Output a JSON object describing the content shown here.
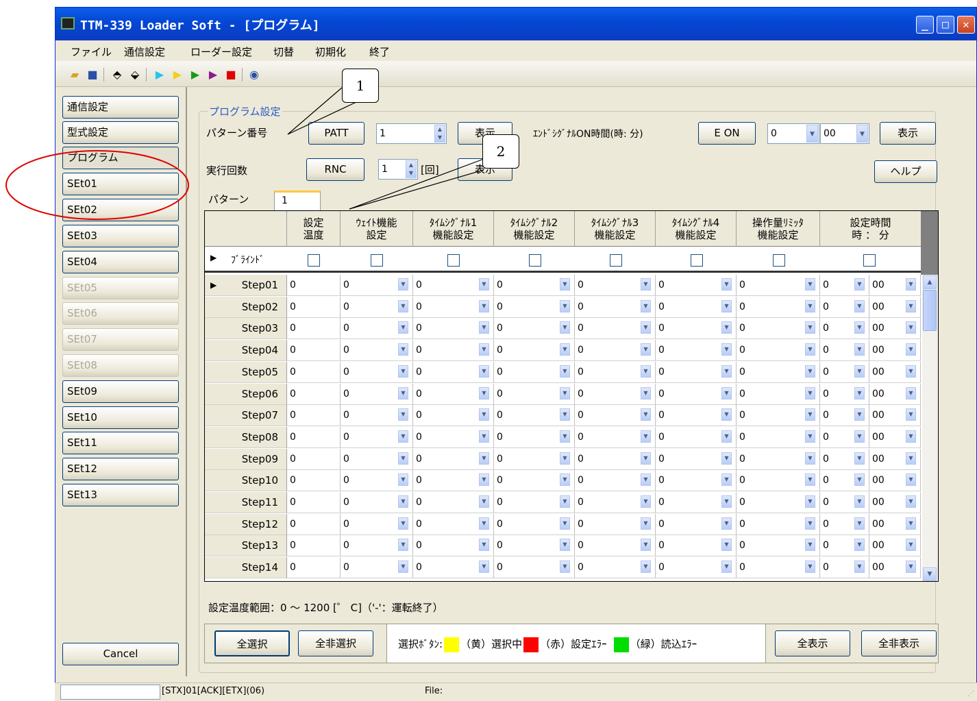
{
  "window": {
    "title": "TTM-339 Loader Soft - [プログラム]"
  },
  "menu": [
    "ファイル",
    "通信設定",
    "ローダー設定",
    "切替",
    "初期化",
    "終了"
  ],
  "toolbar": {
    "icons": [
      "open-folder-icon",
      "save-icon",
      "upload-icon",
      "download-icon",
      "play-cyan-icon",
      "play-yellow-icon",
      "play-green-icon",
      "play-purple-icon",
      "stop-red-icon",
      "help-icon"
    ]
  },
  "sidebar": {
    "items": [
      {
        "label": "通信設定",
        "enabled": true
      },
      {
        "label": "型式設定",
        "enabled": true
      },
      {
        "label": "プログラム",
        "enabled": true
      },
      {
        "label": "SEt01",
        "enabled": true
      },
      {
        "label": "SEt02",
        "enabled": true
      },
      {
        "label": "SEt03",
        "enabled": true
      },
      {
        "label": "SEt04",
        "enabled": true
      },
      {
        "label": "SEt05",
        "enabled": false
      },
      {
        "label": "SEt06",
        "enabled": false
      },
      {
        "label": "SEt07",
        "enabled": false
      },
      {
        "label": "SEt08",
        "enabled": false
      },
      {
        "label": "SEt09",
        "enabled": true
      },
      {
        "label": "SEt10",
        "enabled": true
      },
      {
        "label": "SEt11",
        "enabled": true
      },
      {
        "label": "SEt12",
        "enabled": true
      },
      {
        "label": "SEt13",
        "enabled": true
      }
    ],
    "cancel": "Cancel"
  },
  "program": {
    "group_title": "プログラム設定",
    "pattern_no_label": "パターン番号",
    "patt_button": "PATT",
    "pattern_value": "1",
    "show_button": "表示",
    "end_signal_label": "ｴﾝﾄﾞｼｸﾞﾅﾙON時間(時: 分)",
    "eon_button": "E ON",
    "eon_hour": "0",
    "eon_min": "00",
    "show_button2": "表示",
    "run_count_label": "実行回数",
    "rnc_button": "RNC",
    "run_count_value": "1",
    "run_unit": "[回]",
    "show_button3": "表示",
    "help_button": "ヘルプ",
    "pattern_tab_label": "パターン",
    "pattern_tab": "1"
  },
  "grid": {
    "headers": [
      [
        "設定",
        "温度"
      ],
      [
        "ｳｪｲﾄ機能",
        "設定"
      ],
      [
        "ﾀｲﾑｼｸﾞﾅﾙ1",
        "機能設定"
      ],
      [
        "ﾀｲﾑｼｸﾞﾅﾙ2",
        "機能設定"
      ],
      [
        "ﾀｲﾑｼｸﾞﾅﾙ3",
        "機能設定"
      ],
      [
        "ﾀｲﾑｼｸﾞﾅﾙ4",
        "機能設定"
      ],
      [
        "操作量ﾘﾐｯﾀ",
        "機能設定"
      ],
      [
        "設定時間",
        "時 ： 分"
      ]
    ],
    "blind_label": "ﾌﾞﾗｲﾝﾄﾞ",
    "rows": [
      {
        "step": "Step01",
        "vals": [
          "0",
          "0",
          "0",
          "0",
          "0",
          "0",
          "0",
          "0",
          "00"
        ]
      },
      {
        "step": "Step02",
        "vals": [
          "0",
          "0",
          "0",
          "0",
          "0",
          "0",
          "0",
          "0",
          "00"
        ]
      },
      {
        "step": "Step03",
        "vals": [
          "0",
          "0",
          "0",
          "0",
          "0",
          "0",
          "0",
          "0",
          "00"
        ]
      },
      {
        "step": "Step04",
        "vals": [
          "0",
          "0",
          "0",
          "0",
          "0",
          "0",
          "0",
          "0",
          "00"
        ]
      },
      {
        "step": "Step05",
        "vals": [
          "0",
          "0",
          "0",
          "0",
          "0",
          "0",
          "0",
          "0",
          "00"
        ]
      },
      {
        "step": "Step06",
        "vals": [
          "0",
          "0",
          "0",
          "0",
          "0",
          "0",
          "0",
          "0",
          "00"
        ]
      },
      {
        "step": "Step07",
        "vals": [
          "0",
          "0",
          "0",
          "0",
          "0",
          "0",
          "0",
          "0",
          "00"
        ]
      },
      {
        "step": "Step08",
        "vals": [
          "0",
          "0",
          "0",
          "0",
          "0",
          "0",
          "0",
          "0",
          "00"
        ]
      },
      {
        "step": "Step09",
        "vals": [
          "0",
          "0",
          "0",
          "0",
          "0",
          "0",
          "0",
          "0",
          "00"
        ]
      },
      {
        "step": "Step10",
        "vals": [
          "0",
          "0",
          "0",
          "0",
          "0",
          "0",
          "0",
          "0",
          "00"
        ]
      },
      {
        "step": "Step11",
        "vals": [
          "0",
          "0",
          "0",
          "0",
          "0",
          "0",
          "0",
          "0",
          "00"
        ]
      },
      {
        "step": "Step12",
        "vals": [
          "0",
          "0",
          "0",
          "0",
          "0",
          "0",
          "0",
          "0",
          "00"
        ]
      },
      {
        "step": "Step13",
        "vals": [
          "0",
          "0",
          "0",
          "0",
          "0",
          "0",
          "0",
          "0",
          "00"
        ]
      },
      {
        "step": "Step14",
        "vals": [
          "0",
          "0",
          "0",
          "0",
          "0",
          "0",
          "0",
          "0",
          "00"
        ]
      }
    ]
  },
  "footer": {
    "range_note": "設定温度範囲：0 ～ 1200 [゜ C]（'-'：運転終了）",
    "select_all": "全選択",
    "deselect_all": "全非選択",
    "legend_prefix": "選択ﾎﾞﾀﾝ:",
    "legend_yellow": "（黄）選択中",
    "legend_red": "（赤）設定ｴﾗｰ",
    "legend_green": "（緑）読込ｴﾗｰ",
    "show_all": "全表示",
    "hide_all": "全非表示",
    "colors": {
      "yellow": "#ffff00",
      "red": "#ff0000",
      "green": "#00dd00"
    }
  },
  "status": {
    "text": "[STX]01[ACK][ETX](06)",
    "file_label": "File:"
  },
  "annotations": {
    "callout1": "1",
    "callout2": "2"
  }
}
